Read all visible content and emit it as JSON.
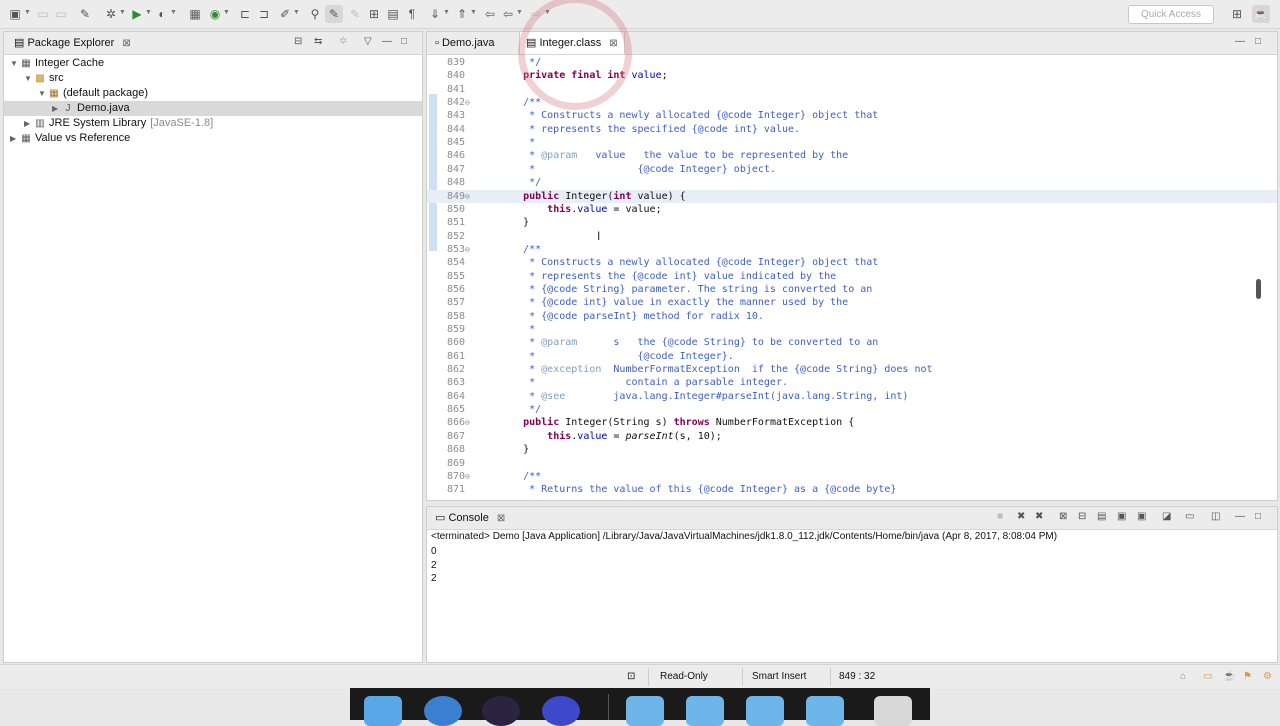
{
  "toolbar": {
    "quick_access_placeholder": "Quick Access",
    "icons": [
      "new-icon",
      "save-icon",
      "save-all-icon",
      "build-icon",
      "debug-icon",
      "run-icon",
      "external-tools-icon",
      "new-java-project-icon",
      "new-class-icon",
      "open-type-icon",
      "search-icon",
      "toggle-mark-occurrences-icon",
      "next-annotation-icon",
      "back-icon",
      "forward-icon"
    ]
  },
  "package_explorer": {
    "title": "Package Explorer",
    "tree": [
      {
        "label": "Integer Cache",
        "level": 0,
        "expanded": true,
        "icon": "project-icon",
        "suffix": ""
      },
      {
        "label": "src",
        "level": 1,
        "expanded": true,
        "icon": "source-folder-icon",
        "suffix": ""
      },
      {
        "label": "(default package)",
        "level": 2,
        "expanded": true,
        "icon": "package-icon",
        "suffix": ""
      },
      {
        "label": "Demo.java",
        "level": 3,
        "expanded": false,
        "icon": "java-file-icon",
        "suffix": "",
        "selected": true
      },
      {
        "label": "JRE System Library",
        "level": 1,
        "expanded": false,
        "icon": "library-icon",
        "suffix": "[JavaSE-1.8]"
      },
      {
        "label": "Value vs Reference",
        "level": 0,
        "expanded": false,
        "icon": "project-icon",
        "suffix": ""
      }
    ]
  },
  "editor": {
    "tabs": [
      {
        "label": "Demo.java",
        "active": false
      },
      {
        "label": "Integer.class",
        "active": true
      }
    ],
    "cursor_line": 849,
    "lines": [
      {
        "n": "839",
        "fold": false,
        "text": "     */",
        "t": "c"
      },
      {
        "n": "840",
        "fold": false,
        "text": "    private final int value;",
        "t": "decl"
      },
      {
        "n": "841",
        "fold": false,
        "text": "",
        "t": "c"
      },
      {
        "n": "842",
        "fold": true,
        "text": "    /**",
        "t": "c"
      },
      {
        "n": "843",
        "fold": false,
        "text": "     * Constructs a newly allocated {@code Integer} object that",
        "t": "c"
      },
      {
        "n": "844",
        "fold": false,
        "text": "     * represents the specified {@code int} value.",
        "t": "c"
      },
      {
        "n": "845",
        "fold": false,
        "text": "     *",
        "t": "c"
      },
      {
        "n": "846",
        "fold": false,
        "text": "     * @param   value   the value to be represented by the",
        "t": "c"
      },
      {
        "n": "847",
        "fold": false,
        "text": "     *                 {@code Integer} object.",
        "t": "c"
      },
      {
        "n": "848",
        "fold": false,
        "text": "     */",
        "t": "c"
      },
      {
        "n": "849",
        "fold": true,
        "text": "    public Integer(int value) {",
        "t": "ctor1"
      },
      {
        "n": "850",
        "fold": false,
        "text": "        this.value = value;",
        "t": "assign1"
      },
      {
        "n": "851",
        "fold": false,
        "text": "    }",
        "t": "plain"
      },
      {
        "n": "852",
        "fold": false,
        "text": "",
        "t": "plain"
      },
      {
        "n": "853",
        "fold": true,
        "text": "    /**",
        "t": "c"
      },
      {
        "n": "854",
        "fold": false,
        "text": "     * Constructs a newly allocated {@code Integer} object that",
        "t": "c"
      },
      {
        "n": "855",
        "fold": false,
        "text": "     * represents the {@code int} value indicated by the",
        "t": "c"
      },
      {
        "n": "856",
        "fold": false,
        "text": "     * {@code String} parameter. The string is converted to an",
        "t": "c"
      },
      {
        "n": "857",
        "fold": false,
        "text": "     * {@code int} value in exactly the manner used by the",
        "t": "c"
      },
      {
        "n": "858",
        "fold": false,
        "text": "     * {@code parseInt} method for radix 10.",
        "t": "c"
      },
      {
        "n": "859",
        "fold": false,
        "text": "     *",
        "t": "c"
      },
      {
        "n": "860",
        "fold": false,
        "text": "     * @param      s   the {@code String} to be converted to an",
        "t": "c"
      },
      {
        "n": "861",
        "fold": false,
        "text": "     *                 {@code Integer}.",
        "t": "c"
      },
      {
        "n": "862",
        "fold": false,
        "text": "     * @exception  NumberFormatException  if the {@code String} does not",
        "t": "c"
      },
      {
        "n": "863",
        "fold": false,
        "text": "     *               contain a parsable integer.",
        "t": "c"
      },
      {
        "n": "864",
        "fold": false,
        "text": "     * @see        java.lang.Integer#parseInt(java.lang.String, int)",
        "t": "c"
      },
      {
        "n": "865",
        "fold": false,
        "text": "     */",
        "t": "c"
      },
      {
        "n": "866",
        "fold": true,
        "text": "    public Integer(String s) throws NumberFormatException {",
        "t": "ctor2"
      },
      {
        "n": "867",
        "fold": false,
        "text": "        this.value = parseInt(s, 10);",
        "t": "assign2"
      },
      {
        "n": "868",
        "fold": false,
        "text": "    }",
        "t": "plain"
      },
      {
        "n": "869",
        "fold": false,
        "text": "",
        "t": "plain"
      },
      {
        "n": "870",
        "fold": true,
        "text": "    /**",
        "t": "c"
      },
      {
        "n": "871",
        "fold": false,
        "text": "     * Returns the value of this {@code Integer} as a {@code byte}",
        "t": "c"
      }
    ]
  },
  "console": {
    "title": "Console",
    "header": "<terminated> Demo [Java Application] /Library/Java/JavaVirtualMachines/jdk1.8.0_112.jdk/Contents/Home/bin/java (Apr 8, 2017, 8:08:04 PM)",
    "output": [
      "0",
      "2",
      "2"
    ]
  },
  "status_bar": {
    "mode": "Read-Only",
    "insert_mode": "Smart Insert",
    "position": "849 : 32"
  },
  "colors": {
    "comment": "#3f5fbf",
    "keyword": "#7f0055",
    "field": "#0000c0",
    "javadoc_tag": "#7f9fbf",
    "current_line": "#e8eef8"
  }
}
